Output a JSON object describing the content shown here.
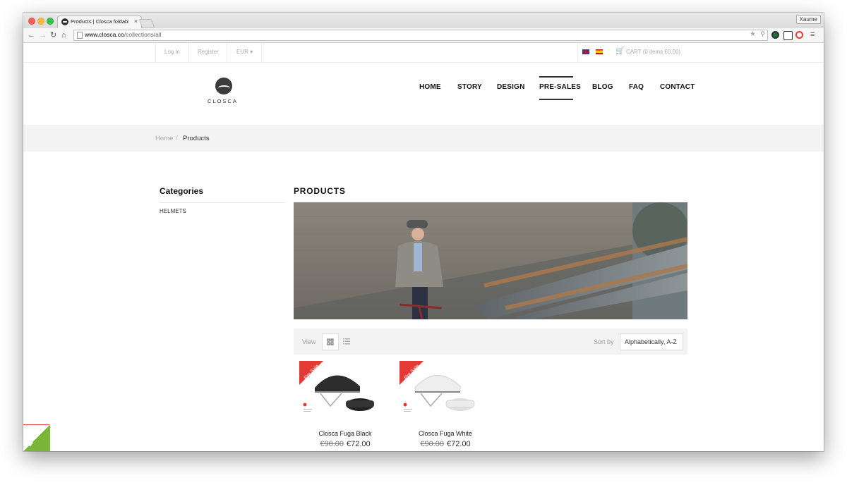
{
  "browser": {
    "tab_title": "Products | Closca foldable",
    "tab_close": "×",
    "user_button": "Xaume",
    "url_host": "www.closca.co",
    "url_path": "/collections/all"
  },
  "topbar": {
    "login": "Log in",
    "register": "Register",
    "currency": "EUR",
    "cart": "CART (0 items €0.00)"
  },
  "header": {
    "logo_text": "CLOSCA",
    "nav": [
      "HOME",
      "STORY",
      "DESIGN",
      "PRE-SALES",
      "BLOG",
      "FAQ",
      "CONTACT"
    ],
    "active_nav": "PRE-SALES"
  },
  "breadcrumb": {
    "home": "Home",
    "separator": "/",
    "current": "Products"
  },
  "sidebar": {
    "title": "Categories",
    "items": [
      "HELMETS"
    ]
  },
  "main": {
    "title": "PRODUCTS",
    "view_label": "View",
    "sort_label": "Sort by",
    "sort_value": "Alphabetically, A-Z",
    "products": [
      {
        "name": "Closca Fuga Black",
        "old_price": "€90.00",
        "price": "€72.00",
        "badge": "Pre Sale",
        "color": "black"
      },
      {
        "name": "Closca Fuga White",
        "old_price": "€90.00",
        "price": "€72.00",
        "badge": "Pre Sale",
        "color": "white"
      }
    ]
  },
  "colors": {
    "accent_red": "#e53935",
    "cart_blue": "#5aa6d8",
    "badge_green": "#7ab53a"
  }
}
